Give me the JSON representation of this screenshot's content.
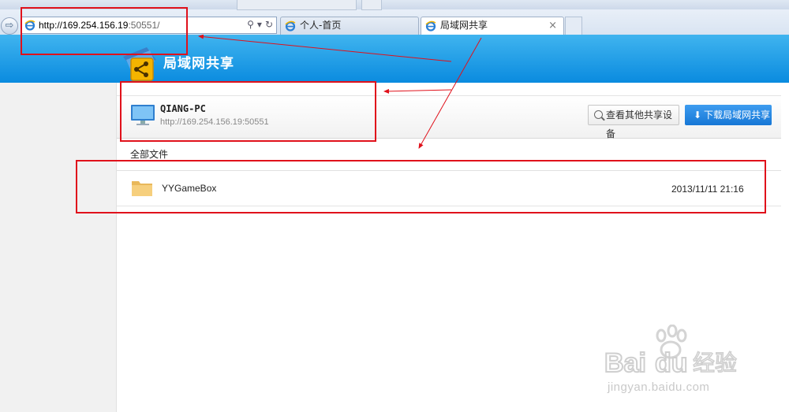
{
  "browser": {
    "address": {
      "host": "http://169.254.156.19",
      "port": ":50551/"
    },
    "tabs": [
      {
        "label": "个人-首页",
        "active": false
      },
      {
        "label": "局域网共享",
        "active": true
      }
    ],
    "close_glyph": "×"
  },
  "site": {
    "title": "局域网共享"
  },
  "device": {
    "name": "QIANG-PC",
    "url": "http://169.254.156.19:50551",
    "other_devices_button": "查看其他共享设备",
    "download_button": "下载局域网共享"
  },
  "files": {
    "breadcrumb": "全部文件",
    "items": [
      {
        "name": "YYGameBox",
        "date": "2013/11/11 21:16",
        "icon": "folder-icon"
      }
    ]
  },
  "watermark": {
    "brand": "Baidu 经验",
    "url": "jingyan.baidu.com"
  },
  "colors": {
    "header": "#1b9ae6",
    "download_button": "#2a88e3",
    "annotation": "#e0111b"
  }
}
